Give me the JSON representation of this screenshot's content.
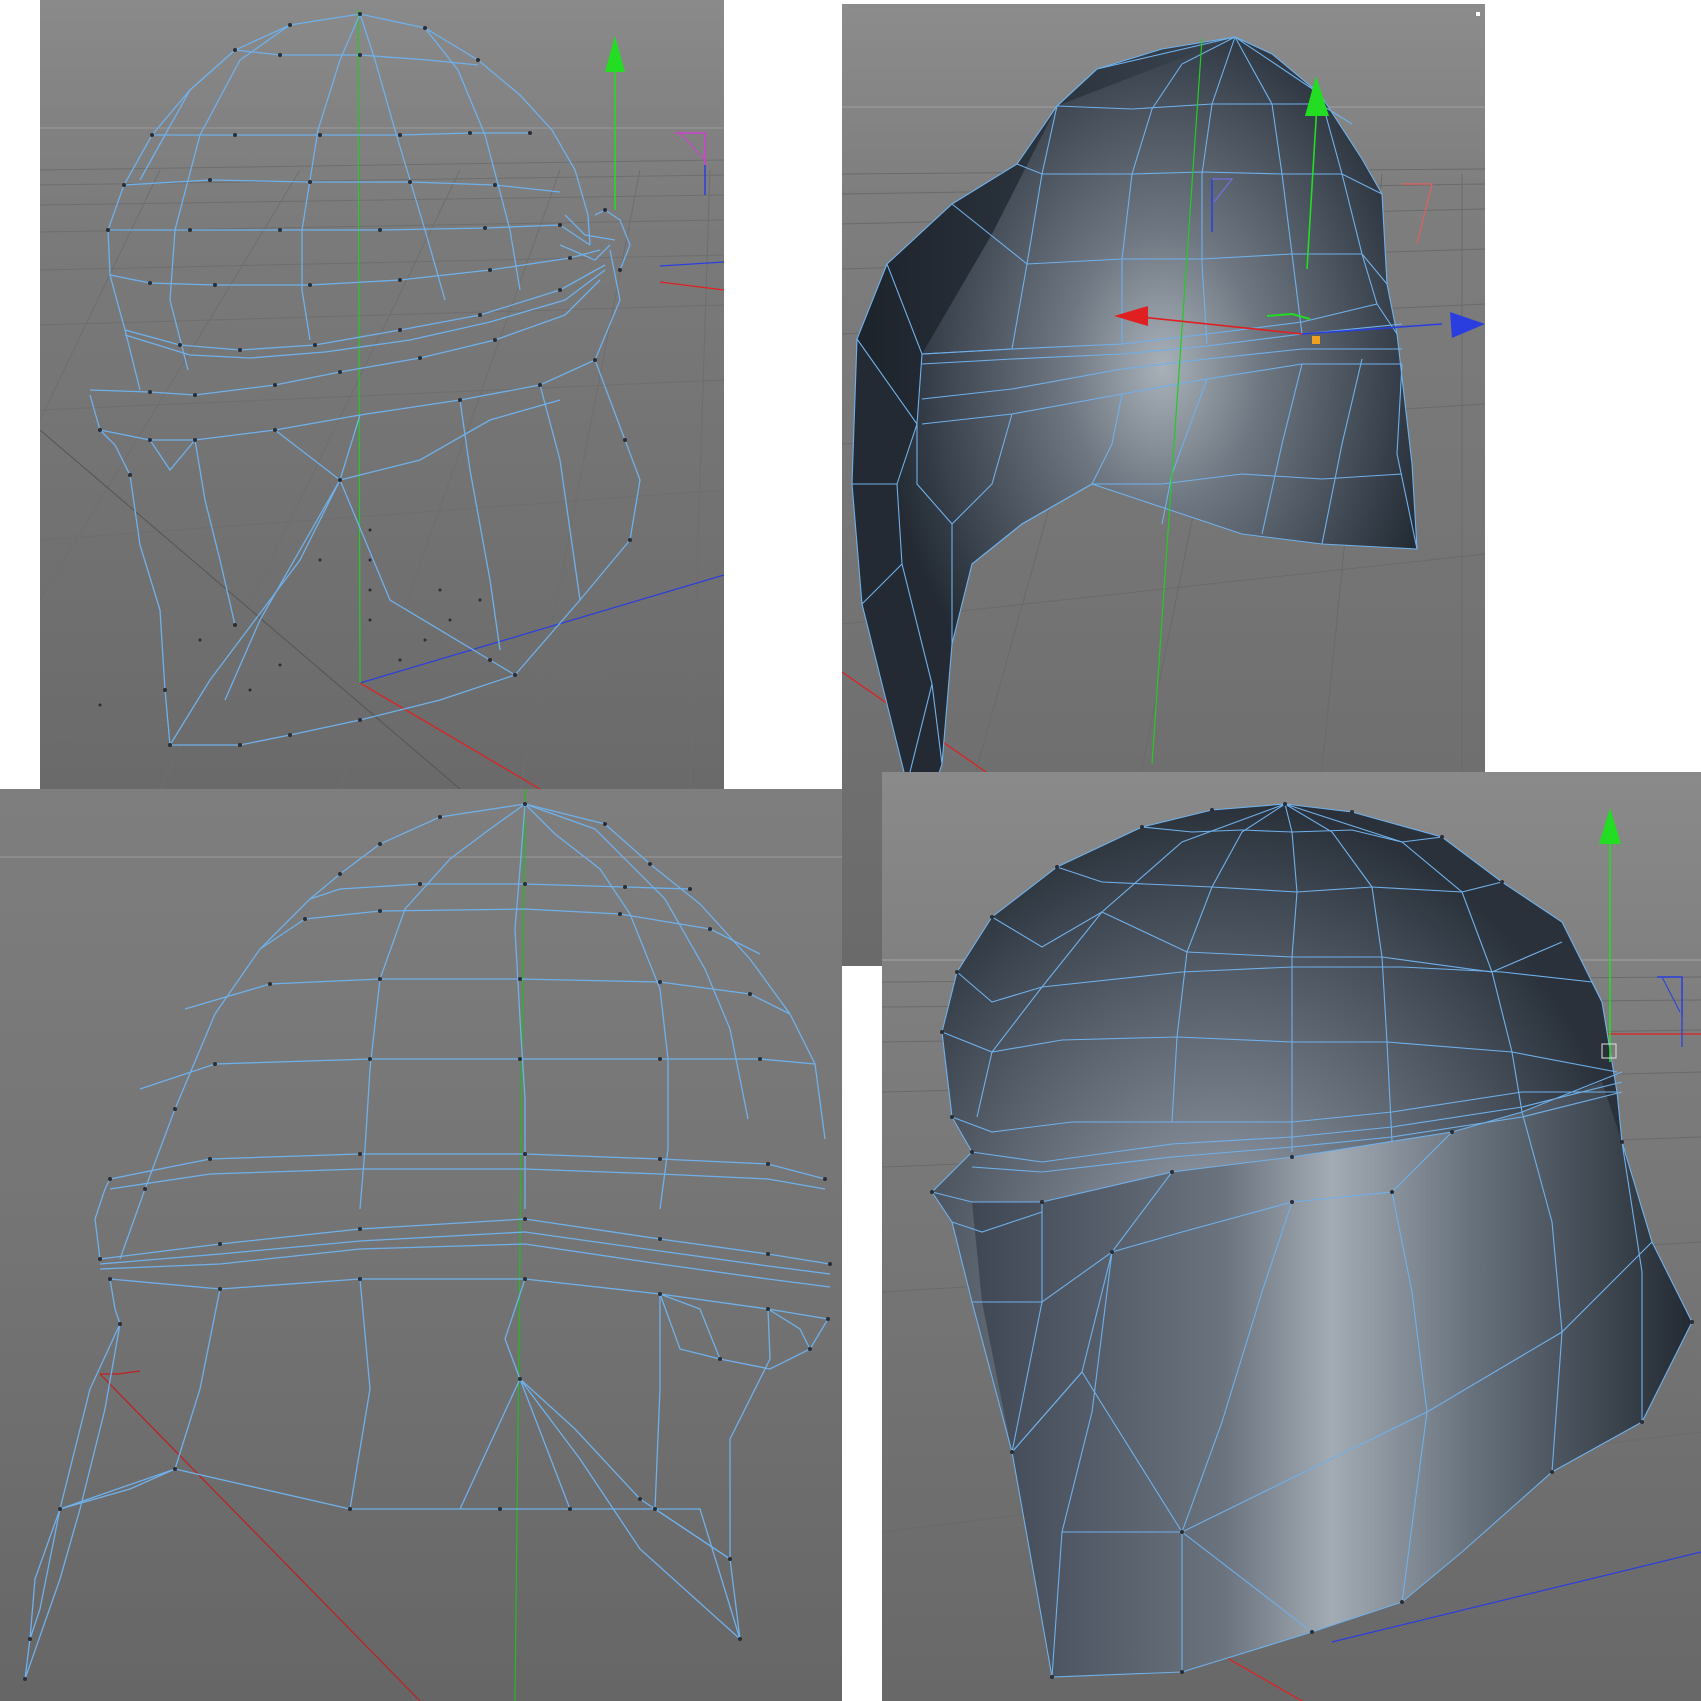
{
  "window": {
    "title": ""
  },
  "viewports": [
    {
      "id": "top-left",
      "mode": "wireframe",
      "label": ""
    },
    {
      "id": "top-right",
      "mode": "shaded-wireframe",
      "label": ""
    },
    {
      "id": "bottom-left",
      "mode": "wireframe",
      "label": ""
    },
    {
      "id": "bottom-right",
      "mode": "shaded-wireframe",
      "label": ""
    }
  ],
  "colors": {
    "viewport_background": "#7d7d7d",
    "wire": "#6fb0ea",
    "mesh_shade_dark": "#2b323b",
    "mesh_shade_light": "#9aa3ad",
    "axis_y": "#22dd22",
    "axis_x": "#e02020",
    "axis_z": "#2a3ee0",
    "grid": "#6c6c6c",
    "page_background": "#ffffff"
  },
  "icons": [
    "axis-gizmo-y-icon",
    "axis-gizmo-x-icon",
    "axis-gizmo-z-icon",
    "world-axis-icon",
    "object-pivot-icon"
  ]
}
